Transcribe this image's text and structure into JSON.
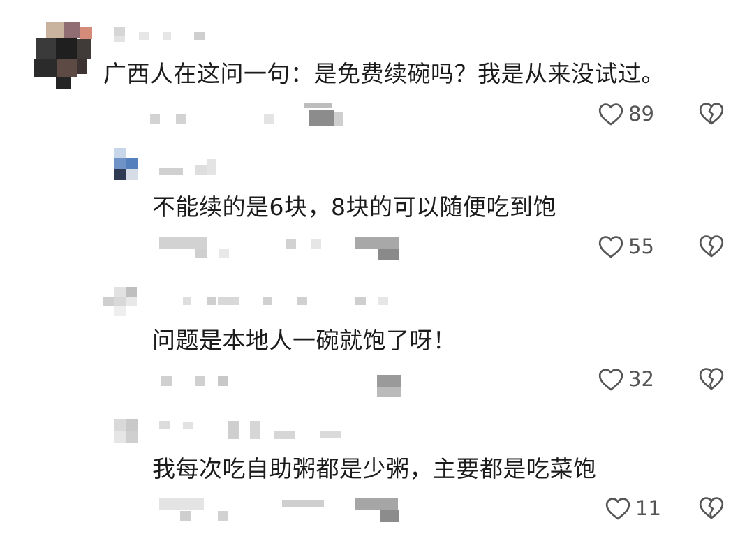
{
  "comments": [
    {
      "text": "广西人在这问一句：是免费续碗吗？我是从来没试过。",
      "likes": "89"
    },
    {
      "text": "不能续的是6块，8块的可以随便吃到饱",
      "likes": "55"
    },
    {
      "text": "问题是本地人一碗就饱了呀！",
      "likes": "32"
    },
    {
      "text": "我每次吃自助粥都是少粥，主要都是吃菜饱",
      "likes": "11"
    }
  ],
  "icons": {
    "like": "heart-outline-icon",
    "dislike": "broken-heart-icon"
  },
  "colors": {
    "text": "#1b1b1b",
    "muted": "#555555",
    "icon": "#555555",
    "background": "#ffffff"
  }
}
